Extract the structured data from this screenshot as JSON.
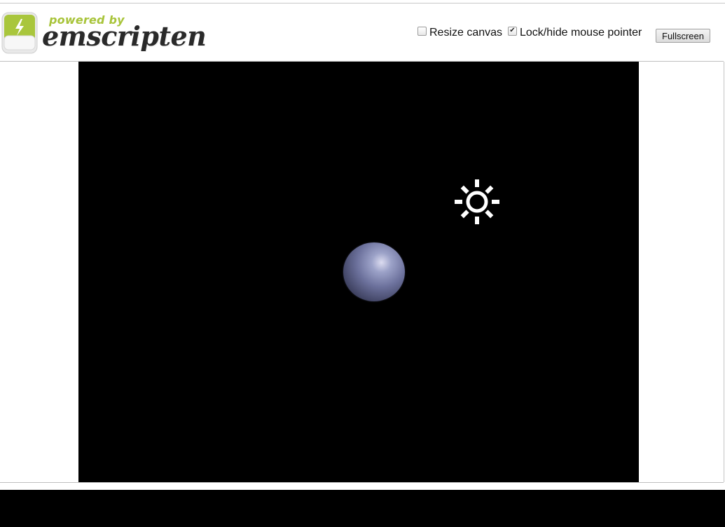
{
  "header": {
    "logo": {
      "powered_text": "powered by",
      "brand_text": "emscripten"
    },
    "controls": {
      "resize_canvas": {
        "label": "Resize canvas",
        "checked": false
      },
      "lock_pointer": {
        "label": "Lock/hide mouse pointer",
        "checked": true
      },
      "fullscreen_label": "Fullscreen"
    }
  },
  "canvas": {
    "background": "#000000",
    "objects": [
      "sun-light-icon",
      "sphere"
    ],
    "sphere_color": "#6c719c"
  },
  "colors": {
    "brand_green": "#a8c43a",
    "brand_dark": "#2a2a2a",
    "console_bg": "#000000"
  }
}
